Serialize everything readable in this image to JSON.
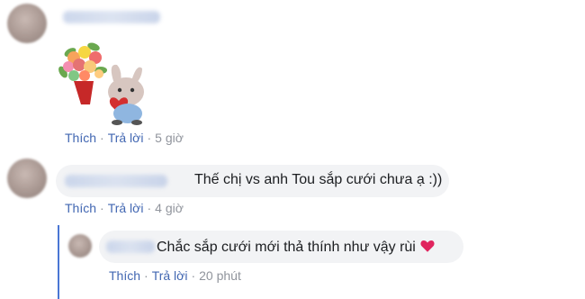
{
  "comments": [
    {
      "actions": {
        "like": "Thích",
        "reply": "Trả lời",
        "time": "5 giờ"
      }
    },
    {
      "text": "Thế chị vs anh Tou sắp cưới chưa ạ :))",
      "actions": {
        "like": "Thích",
        "reply": "Trả lời",
        "time": "4 giờ"
      }
    },
    {
      "text": "Chắc sắp cưới mới thả thính như vậy rùi",
      "emoji": "heart-icon",
      "actions": {
        "like": "Thích",
        "reply": "Trả lời",
        "time": "20 phút"
      }
    }
  ],
  "separator": "·",
  "colors": {
    "bubble": "#f2f3f5",
    "link": "#4267b2",
    "meta": "#90949c",
    "reply_line": "#4a76d4",
    "heart": "#e0245e"
  }
}
